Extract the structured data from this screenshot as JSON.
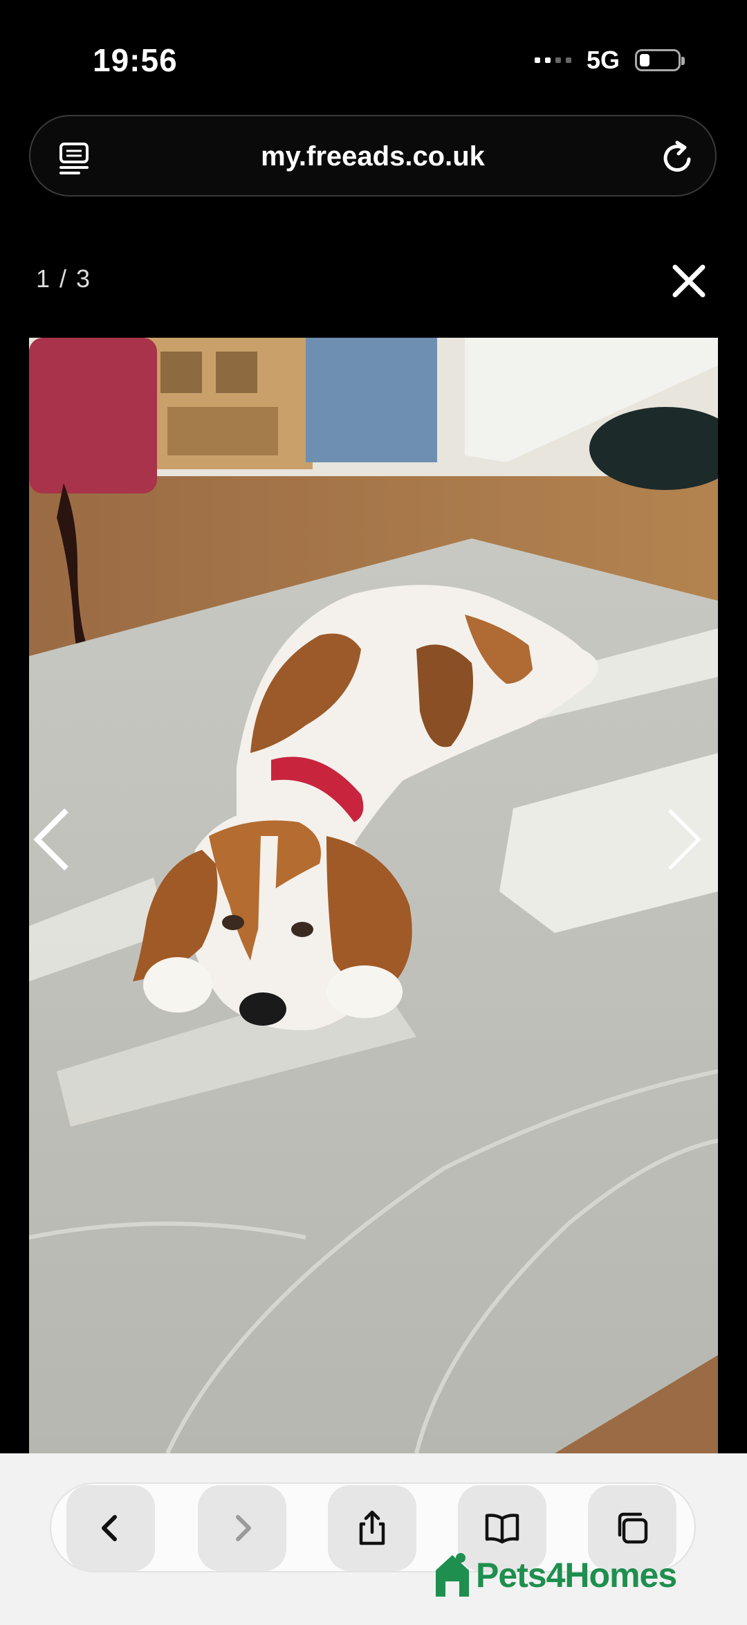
{
  "status_bar": {
    "time": "19:56",
    "network": "5G",
    "battery_level": 0.2
  },
  "browser": {
    "url": "my.freeads.co.uk",
    "icons": {
      "reader": "reader-icon",
      "reload": "reload-icon"
    }
  },
  "gallery": {
    "counter": "1 / 3",
    "current": 1,
    "total": 3,
    "photo_subject": "beagle puppy lying on a grey rug",
    "icons": {
      "close": "close-icon",
      "prev": "chevron-left-icon",
      "next": "chevron-right-icon"
    }
  },
  "toolbar": {
    "icons": [
      "back-icon",
      "forward-icon",
      "share-icon",
      "bookmarks-icon",
      "tabs-icon"
    ]
  },
  "watermark": {
    "text": "Pets4Homes",
    "color": "#1e8f4e"
  }
}
